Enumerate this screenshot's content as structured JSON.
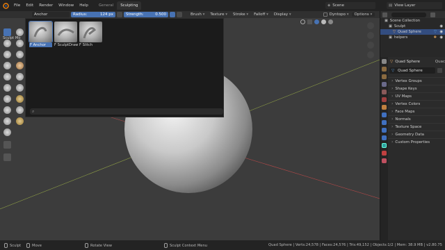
{
  "topbar": {
    "menus": [
      "File",
      "Edit",
      "Render",
      "Window",
      "Help"
    ],
    "workspace_tabs": [
      "General",
      "Sculpting"
    ],
    "active_tab": "Sculpting",
    "scene": "Scene",
    "view_layer": "View Layer"
  },
  "tool_header": {
    "brush_name": "Anchor",
    "radius_label": "Radius:",
    "radius_value": "124 px",
    "strength_label": "Strength:",
    "strength_value": "0.500",
    "dropdowns": [
      "Brush",
      "Texture",
      "Stroke",
      "Falloff",
      "Display"
    ],
    "dyntopo": "Dyntopo",
    "options": "Options"
  },
  "viewport": {
    "mode_label": "Sculpt Mo",
    "brush_popup": {
      "brushes": [
        {
          "label": "F Anchor",
          "selected": true
        },
        {
          "label": "F SculptDraw",
          "selected": false
        },
        {
          "label": "F Slitch",
          "selected": false
        }
      ]
    }
  },
  "outliner": {
    "rows": [
      {
        "label": "Scene Collection",
        "indent": 0
      },
      {
        "label": "Sculpt",
        "indent": 1
      },
      {
        "label": "Quad Sphere",
        "indent": 2,
        "selected": true
      },
      {
        "label": "helpers",
        "indent": 1
      }
    ]
  },
  "properties": {
    "object_name": "Quad Sphere",
    "object_name_trunc": "Quac",
    "mesh_name": "Quad Sphere",
    "sections": [
      "Vertex Groups",
      "Shape Keys",
      "UV Maps",
      "Vertex Colors",
      "Face Maps",
      "Normals",
      "Texture Space",
      "Geometry Data",
      "Custom Properties"
    ]
  },
  "statusbar": {
    "left": [
      "Sculpt",
      "Move",
      "Rotate View",
      "Sculpt Context Menu"
    ],
    "stats": "Quad Sphere | Verts:24,578 | Faces:24,576 | Tris:49,152 | Objects:1/2 | Mem: 38.9 MB | v2.80.75"
  },
  "colors": {
    "accent": "#4772b3",
    "background": "#3c3c3c",
    "panel": "#2b2b2b"
  }
}
